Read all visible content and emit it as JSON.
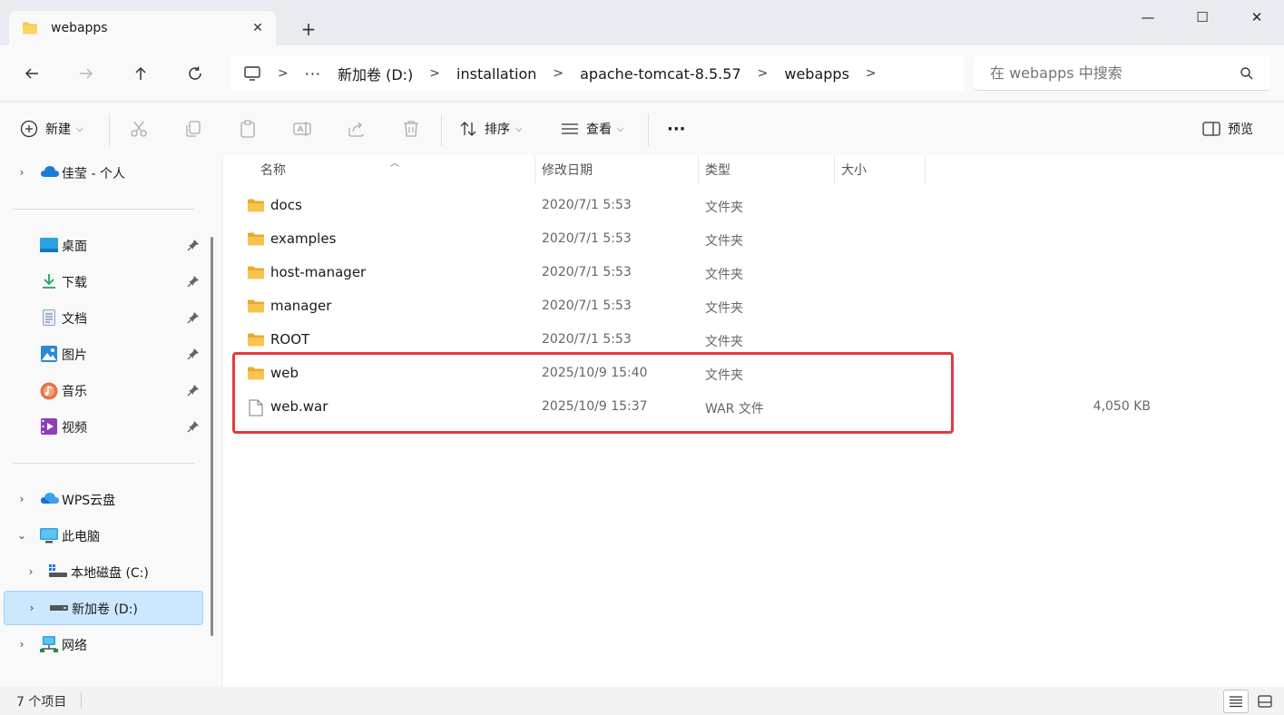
{
  "tab": {
    "title": "webapps",
    "close": "✕",
    "new_tab": "+"
  },
  "window_controls": {
    "minimize": "—",
    "maximize": "☐",
    "close": "✕"
  },
  "address": {
    "overflow": "···",
    "crumbs": [
      "新加卷 (D:)",
      "installation",
      "apache-tomcat-8.5.57",
      "webapps"
    ],
    "separator": ">"
  },
  "search": {
    "placeholder": "在 webapps 中搜索"
  },
  "commands": {
    "new": "新建",
    "sort": "排序",
    "view": "查看",
    "more": "···",
    "preview": "预览"
  },
  "sidebar": {
    "onedrive": "佳莹 - 个人",
    "quick_access": [
      {
        "label": "桌面",
        "icon": "desktop-icon"
      },
      {
        "label": "下载",
        "icon": "download-icon"
      },
      {
        "label": "文档",
        "icon": "document-icon"
      },
      {
        "label": "图片",
        "icon": "pictures-icon"
      },
      {
        "label": "音乐",
        "icon": "music-icon"
      },
      {
        "label": "视频",
        "icon": "video-icon"
      }
    ],
    "wps": "WPS云盘",
    "this_pc": "此电脑",
    "drive_c": "本地磁盘 (C:)",
    "drive_d": "新加卷 (D:)",
    "network": "网络"
  },
  "columns": {
    "name": "名称",
    "modified": "修改日期",
    "type": "类型",
    "size": "大小"
  },
  "files": [
    {
      "name": "docs",
      "modified": "2020/7/1 5:53",
      "type": "文件夹",
      "size": "",
      "kind": "folder"
    },
    {
      "name": "examples",
      "modified": "2020/7/1 5:53",
      "type": "文件夹",
      "size": "",
      "kind": "folder"
    },
    {
      "name": "host-manager",
      "modified": "2020/7/1 5:53",
      "type": "文件夹",
      "size": "",
      "kind": "folder"
    },
    {
      "name": "manager",
      "modified": "2020/7/1 5:53",
      "type": "文件夹",
      "size": "",
      "kind": "folder"
    },
    {
      "name": "ROOT",
      "modified": "2020/7/1 5:53",
      "type": "文件夹",
      "size": "",
      "kind": "folder"
    },
    {
      "name": "web",
      "modified": "2025/10/9 15:40",
      "type": "文件夹",
      "size": "",
      "kind": "folder"
    },
    {
      "name": "web.war",
      "modified": "2025/10/9 15:37",
      "type": "WAR 文件",
      "size": "4,050 KB",
      "kind": "file"
    }
  ],
  "status": {
    "count": "7 个项目"
  },
  "colors": {
    "highlight": "#e8383d",
    "selected": "#cce8ff",
    "folder": "#f8c44f"
  }
}
